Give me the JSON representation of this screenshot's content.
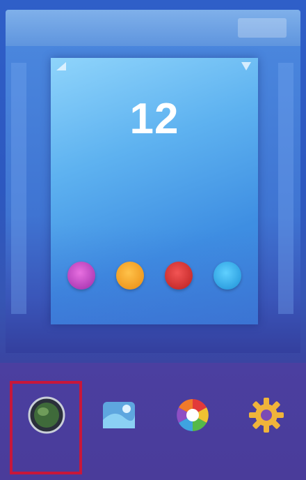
{
  "header": {
    "title": "",
    "action_label": ""
  },
  "preview": {
    "clock": "12",
    "sub1": "",
    "sub2": ""
  },
  "dock_apps": [
    {
      "label": "",
      "color": "#b53bb8"
    },
    {
      "label": "",
      "color": "#f4a020"
    },
    {
      "label": "",
      "color": "#d63030"
    },
    {
      "label": "",
      "color": "#2aa8e6"
    }
  ],
  "options": [
    {
      "label": "",
      "icon": "widgets-apps-icon"
    },
    {
      "label": "",
      "icon": "wallpaper-icon"
    },
    {
      "label": "",
      "icon": "themes-icon"
    },
    {
      "label": "",
      "icon": "home-settings-icon"
    }
  ],
  "colors": {
    "selection_border": "#c8173a",
    "bottom_bar": "#4a3c9a"
  }
}
